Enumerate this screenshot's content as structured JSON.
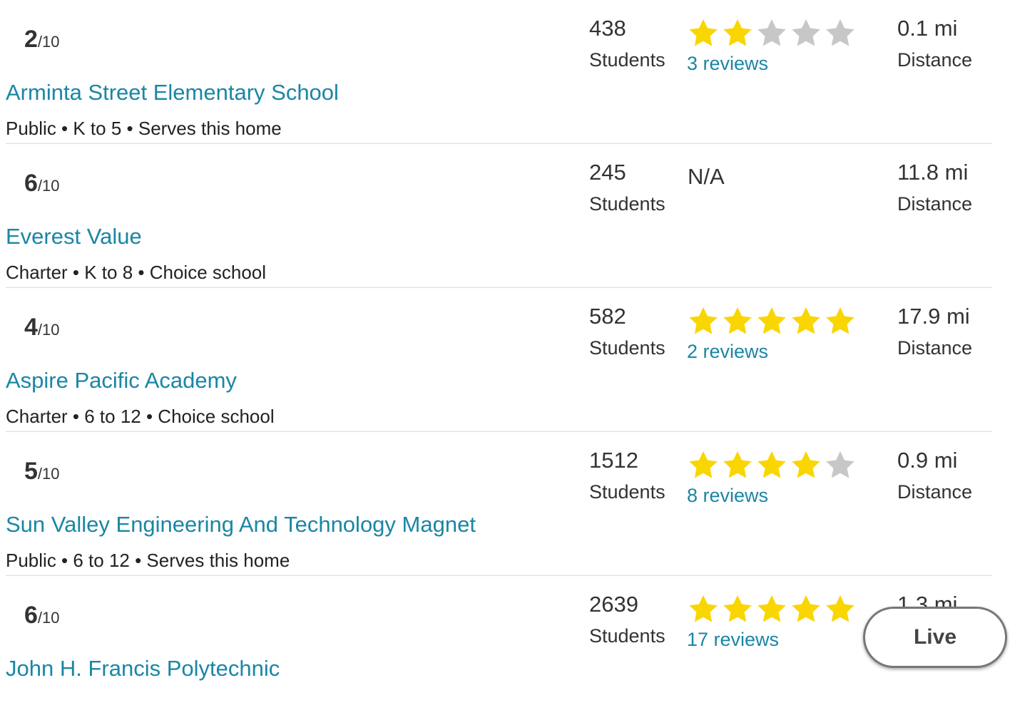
{
  "rating_suffix": "/10",
  "students_label": "Students",
  "distance_label": "Distance",
  "colors": {
    "star_filled": "#f9d600",
    "star_empty": "#c7c7c7",
    "link": "#1a86a5"
  },
  "schools": [
    {
      "rating": "2",
      "name": "Arminta Street Elementary School",
      "meta": "Public • K to 5 • Serves this home",
      "students": "438",
      "stars": 2,
      "reviews": "3 reviews",
      "distance": "0.1 mi"
    },
    {
      "rating": "6",
      "name": "Everest Value",
      "meta": "Charter • K to 8 • Choice school",
      "students": "245",
      "stars": null,
      "no_rating_text": "N/A",
      "reviews": "",
      "distance": "11.8 mi"
    },
    {
      "rating": "4",
      "name": "Aspire Pacific Academy",
      "meta": "Charter • 6 to 12 • Choice school",
      "students": "582",
      "stars": 5,
      "reviews": "2 reviews",
      "distance": "17.9 mi"
    },
    {
      "rating": "5",
      "name": "Sun Valley Engineering And Technology Magnet",
      "meta": "Public • 6 to 12 • Serves this home",
      "students": "1512",
      "stars": 4,
      "reviews": "8 reviews",
      "distance": "0.9 mi"
    },
    {
      "rating": "6",
      "name": "John H. Francis Polytechnic",
      "meta": "",
      "students": "2639",
      "stars": 5,
      "reviews": "17 reviews",
      "distance": "1.3 mi"
    }
  ],
  "live_button": {
    "label": "Live"
  }
}
